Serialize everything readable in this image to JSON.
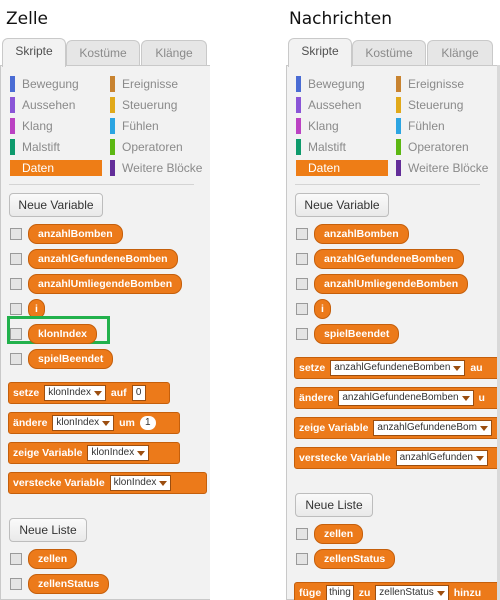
{
  "left": {
    "title": "Zelle",
    "tabs": [
      "Skripte",
      "Kostüme",
      "Klänge"
    ],
    "categories": [
      {
        "label": "Bewegung",
        "color": "#4a6cd4"
      },
      {
        "label": "Ereignisse",
        "color": "#c88330"
      },
      {
        "label": "Aussehen",
        "color": "#8a55d7"
      },
      {
        "label": "Steuerung",
        "color": "#e1a91a"
      },
      {
        "label": "Klang",
        "color": "#bb42c3"
      },
      {
        "label": "Fühlen",
        "color": "#2ca5e2"
      },
      {
        "label": "Malstift",
        "color": "#0e9a6c"
      },
      {
        "label": "Operatoren",
        "color": "#5cb712"
      },
      {
        "label": "Daten",
        "color": "#ee7d16"
      },
      {
        "label": "Weitere Blöcke",
        "color": "#632d99"
      }
    ],
    "new_variable": "Neue Variable",
    "variables": [
      "anzahlBomben",
      "anzahlGefundeneBomben",
      "anzahlUmliegendeBomben",
      "i",
      "klonIndex",
      "spielBeendet"
    ],
    "blocks": {
      "setze": {
        "w1": "setze",
        "var": "klonIndex",
        "w2": "auf",
        "val": "0"
      },
      "aendere": {
        "w1": "ändere",
        "var": "klonIndex",
        "w2": "um",
        "val": "1"
      },
      "zeige": {
        "w1": "zeige Variable",
        "var": "klonIndex"
      },
      "verstecke": {
        "w1": "verstecke Variable",
        "var": "klonIndex"
      }
    },
    "new_list": "Neue Liste",
    "lists": [
      "zellen",
      "zellenStatus"
    ]
  },
  "right": {
    "title": "Nachrichten",
    "tabs": [
      "Skripte",
      "Kostüme",
      "Klänge"
    ],
    "categories": [
      {
        "label": "Bewegung",
        "color": "#4a6cd4"
      },
      {
        "label": "Ereignisse",
        "color": "#c88330"
      },
      {
        "label": "Aussehen",
        "color": "#8a55d7"
      },
      {
        "label": "Steuerung",
        "color": "#e1a91a"
      },
      {
        "label": "Klang",
        "color": "#bb42c3"
      },
      {
        "label": "Fühlen",
        "color": "#2ca5e2"
      },
      {
        "label": "Malstift",
        "color": "#0e9a6c"
      },
      {
        "label": "Operatoren",
        "color": "#5cb712"
      },
      {
        "label": "Daten",
        "color": "#ee7d16"
      },
      {
        "label": "Weitere Blöcke",
        "color": "#632d99"
      }
    ],
    "new_variable": "Neue Variable",
    "variables": [
      "anzahlBomben",
      "anzahlGefundeneBomben",
      "anzahlUmliegendeBomben",
      "i",
      "spielBeendet"
    ],
    "blocks": {
      "setze": {
        "w1": "setze",
        "var": "anzahlGefundeneBomben",
        "w2": "au"
      },
      "aendere": {
        "w1": "ändere",
        "var": "anzahlGefundeneBomben",
        "w2": "u"
      },
      "zeige": {
        "w1": "zeige Variable",
        "var": "anzahlGefundeneBom"
      },
      "verstecke": {
        "w1": "verstecke Variable",
        "var": "anzahlGefunden"
      },
      "fuege": {
        "w1": "füge",
        "val": "thing",
        "w2": "zu",
        "var": "zellenStatus",
        "w3": "hinzu"
      }
    },
    "new_list": "Neue Liste",
    "lists": [
      "zellen",
      "zellenStatus"
    ]
  }
}
